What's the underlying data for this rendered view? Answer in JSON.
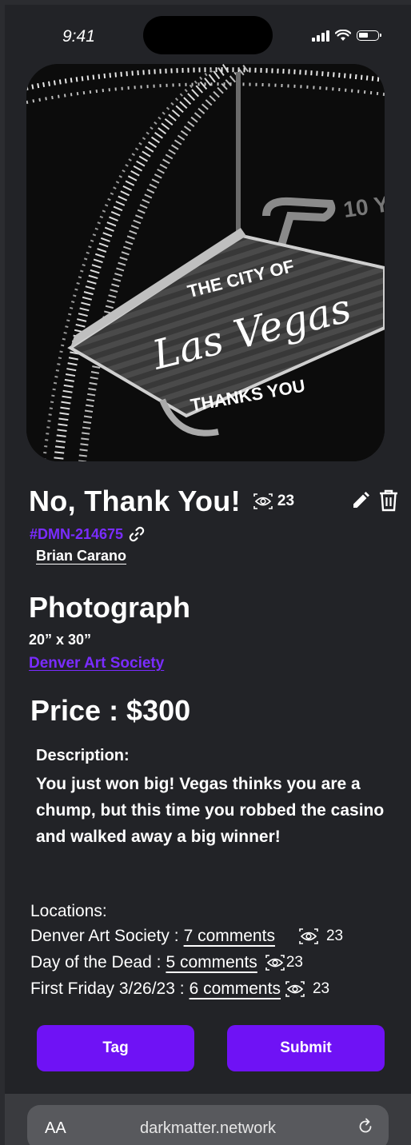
{
  "status_bar": {
    "time": "9:41"
  },
  "artwork": {
    "image_description": "Black and white photo of the Las Vegas sign",
    "sign_line1": "THE CITY OF",
    "sign_line2": "Las Vegas",
    "sign_line3": "THANKS YOU",
    "title": "No, Thank You!",
    "views": "23",
    "id_code": "#DMN-214675",
    "artist": "Brian Carano",
    "medium": "Photograph",
    "dimensions": "20” x 30”",
    "venue": "Denver Art Society",
    "price": "Price : $300",
    "description_label": "Description:",
    "description": "You just won big! Vegas thinks you are a chump, but this time you robbed the casino and walked away a big winner!"
  },
  "locations": {
    "label": "Locations:",
    "items": [
      {
        "name": "Denver Art Society :",
        "comments": "7 comments",
        "views": "23"
      },
      {
        "name": "Day of the Dead :",
        "comments": "5 comments",
        "views": "23"
      },
      {
        "name": "First Friday 3/26/23 :",
        "comments": "6 comments",
        "views": "23"
      }
    ]
  },
  "buttons": {
    "tag": "Tag",
    "submit": "Submit"
  },
  "browser": {
    "text_size_label": "AA",
    "url": "darkmatter.network"
  },
  "colors": {
    "accent": "#6f12f5",
    "link": "#7a2cff",
    "background": "#222327"
  }
}
